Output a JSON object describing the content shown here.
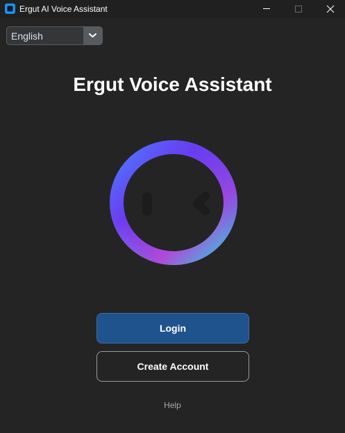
{
  "window": {
    "title": "Ergut AI Voice Assistant",
    "app_icon": "app-square-icon",
    "controls": [
      "minimize-icon",
      "maximize-icon",
      "close-icon"
    ]
  },
  "language_select": {
    "value": "English",
    "icon": "chevron-down-icon"
  },
  "main": {
    "heading": "Ergut Voice Assistant",
    "logo_icon": "gradient-ring-face-logo",
    "login_label": "Login",
    "create_account_label": "Create Account",
    "help_label": "Help"
  },
  "colors": {
    "background": "#242424",
    "login_button": "#1f538d",
    "ring_gradient": [
      "#4a7bff",
      "#6a3cf0",
      "#b04ad8",
      "#30c8e0"
    ]
  }
}
